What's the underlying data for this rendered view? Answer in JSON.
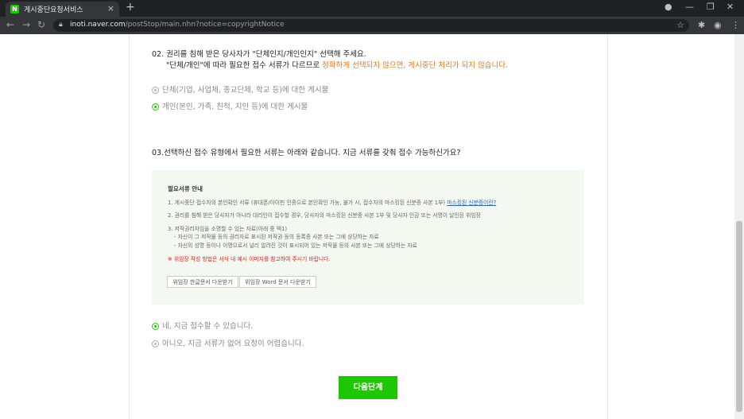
{
  "browser": {
    "tab_title": "게시중단요청서비스",
    "tab_favicon": "N",
    "tab_close": "×",
    "new_tab": "+",
    "url_domain": "inoti.naver.com",
    "url_path": "/postStop/main.nhn?notice=copyrightNotice"
  },
  "q2": {
    "line1": "02. 권리를 침해 받은 당사자가 \"단체인지/개인인지\" 선택해 주세요.",
    "line2_prefix": "\"단체/개인\"에 따라 필요한 접수 서류가 다르므로 ",
    "line2_warn": "정확하게 선택되지 않으면, 게시중단 처리가 되지 않습니다.",
    "options": [
      {
        "label": "단체(기업, 사업체, 종교단체, 학교 등)에 대한 게시물",
        "selected": false
      },
      {
        "label": "개인(본인, 가족, 친척, 지인 등)에 대한 게시물",
        "selected": true
      }
    ]
  },
  "q3": {
    "title": "03.선택하신 접수 유형에서 필요한 서류는 아래와 같습니다. 지금 서류를 갖춰 접수 가능하신가요?"
  },
  "docs": {
    "heading": "필요서류 안내",
    "item1": "1. 게시중단 접수자의 본인확인 서류 (휴대폰/아이핀 인증으로 본인확인 가능, 불가 시, 접수자의 마스킹된 신분증 사본 1부) ",
    "item1_link": "마스킹된 신분증이란?",
    "item2": "2. 권리를 침해 받은 당사자가 아니라 대리인이 접수할 경우, 당사자의 마스킹된 신분증 사본 1부 및 당사자 인감 또는 서명이 날인된 위임장",
    "item3": "3. 저작권리자임을 소명할 수 있는 자료(아래 중 택1)",
    "item3_sub1": "- 자신이 그 저작물 등의 권리자로 표시된 저작권 등의 등록증 사본 또는 그에 상당하는 자료",
    "item3_sub2": "- 자신의 성명 등이나 이명으로서 널리 알려진 것이 표시되어 있는 저작물 등의 사본 또는 그에 상당하는 자료",
    "note": "※ 위임장 작성 방법은 서식 내 예시 이미지를 참고하여 주시기 바랍니다.",
    "btn_hwp": "위임장 한글문서 다운받기",
    "btn_word": "위임장 Word 문서 다운받기"
  },
  "answer": {
    "options": [
      {
        "label": "네, 지금 접수할 수 있습니다.",
        "selected": true
      },
      {
        "label": "아니오, 지금 서류가 없어 요청이 어렵습니다.",
        "selected": false
      }
    ]
  },
  "next_button": "다음단계",
  "colors": {
    "brand_green": "#1ec800",
    "warn_orange": "#e8781a",
    "note_red": "#e02020",
    "box_bg": "#f3f8f1"
  }
}
